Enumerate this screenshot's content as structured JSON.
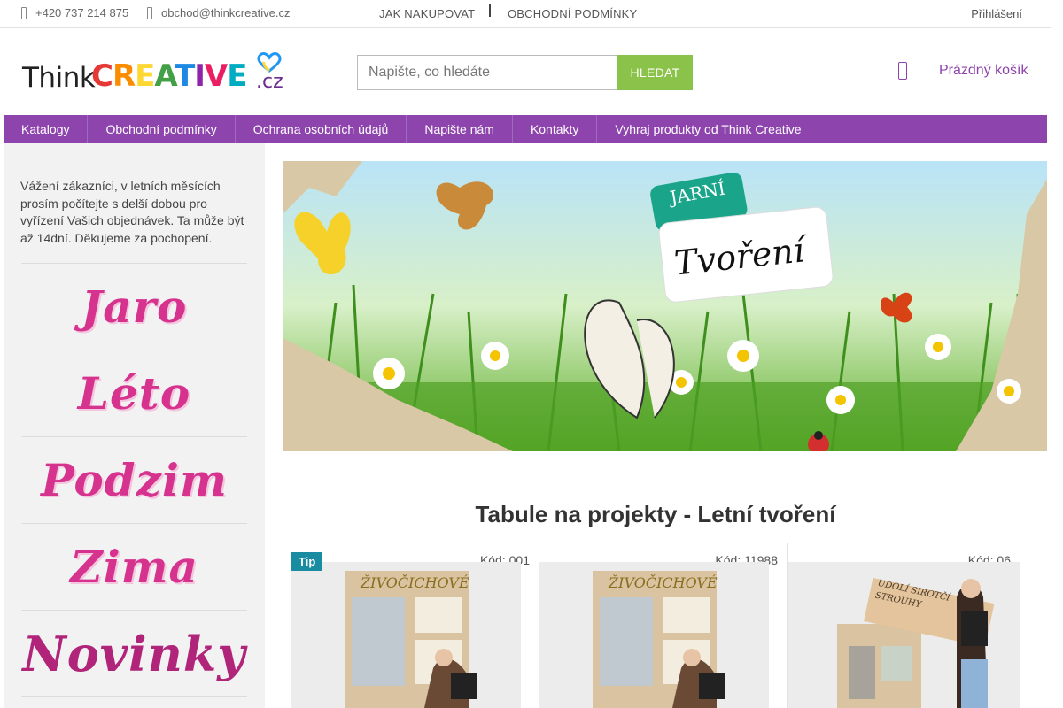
{
  "topbar": {
    "phone": "+420 737 214 875",
    "email": "obchod@thinkcreative.cz",
    "how_to_buy": "JAK NAKUPOVAT",
    "terms": "OBCHODNÍ PODMÍNKY",
    "login": "Přihlášení"
  },
  "logo": {
    "think": "Think",
    "creative_letters": [
      "C",
      "R",
      "E",
      "A",
      "T",
      "I",
      "V",
      "E"
    ],
    "cz": ".cz"
  },
  "search": {
    "placeholder": "Napište, co hledáte",
    "button": "HLEDAT"
  },
  "cart": {
    "label": "Prázdný košík",
    "icon": "shopping-bag-icon"
  },
  "nav": [
    "Katalogy",
    "Obchodní podmínky",
    "Ochrana osobních údajů",
    "Napište nám",
    "Kontakty",
    "Vyhraj produkty od Think Creative"
  ],
  "sidebar": {
    "notice": "Vážení zákazníci, v letních měsících prosím počítejte s delší dobou pro vyřízení Vašich objednávek. Ta může být až 14dní. Děkujeme za pochopení.",
    "seasons": [
      "Jaro",
      "Léto",
      "Podzim",
      "Zima",
      "Novinky"
    ]
  },
  "banner": {
    "badge": "JARNÍ",
    "title": "Tvoření"
  },
  "section_title": "Tabule na projekty - Letní tvoření",
  "products": [
    {
      "code": "Kód: 001",
      "tip": "Tip",
      "board_text": "ŽIVOČICHOVÉ"
    },
    {
      "code": "Kód: 11988",
      "tip": "",
      "board_text": "ŽIVOČICHOVÉ"
    },
    {
      "code": "Kód: 06",
      "tip": "",
      "board_text": "UDOLÍ SIROTČÍ STROUHY"
    }
  ],
  "colors": {
    "brand_purple": "#8e44ad",
    "search_green": "#8bc34a",
    "season_pink": "#d6338f",
    "tip_teal": "#1a8ca1"
  }
}
